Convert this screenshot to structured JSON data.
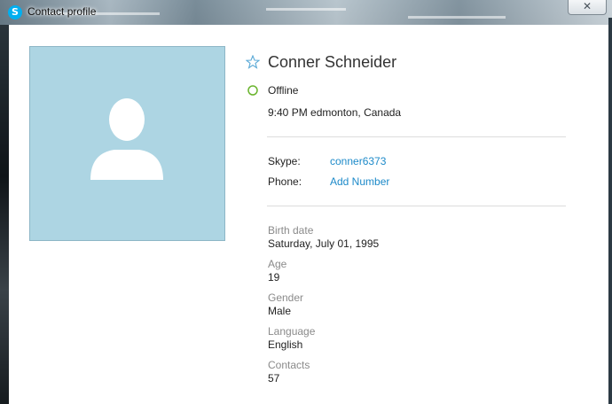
{
  "window": {
    "title": "Contact profile",
    "app_icon_letter": "S",
    "close_glyph": "✕",
    "brand_color": "#00aff0"
  },
  "profile": {
    "name": "Conner Schneider",
    "status": "Offline",
    "status_color": "#6ab42d",
    "local_time": "9:40 PM edmonton, Canada",
    "avatar_bg": "#add5e3",
    "favorite_icon": "star-outline-icon"
  },
  "contact_info": {
    "skype_label": "Skype:",
    "skype_value": "conner6373",
    "phone_label": "Phone:",
    "phone_value": "Add Number",
    "link_color": "#1d8ac9"
  },
  "details": [
    {
      "label": "Birth date",
      "value": "Saturday, July 01, 1995"
    },
    {
      "label": "Age",
      "value": "19"
    },
    {
      "label": "Gender",
      "value": "Male"
    },
    {
      "label": "Language",
      "value": "English"
    },
    {
      "label": "Contacts",
      "value": "57"
    }
  ]
}
